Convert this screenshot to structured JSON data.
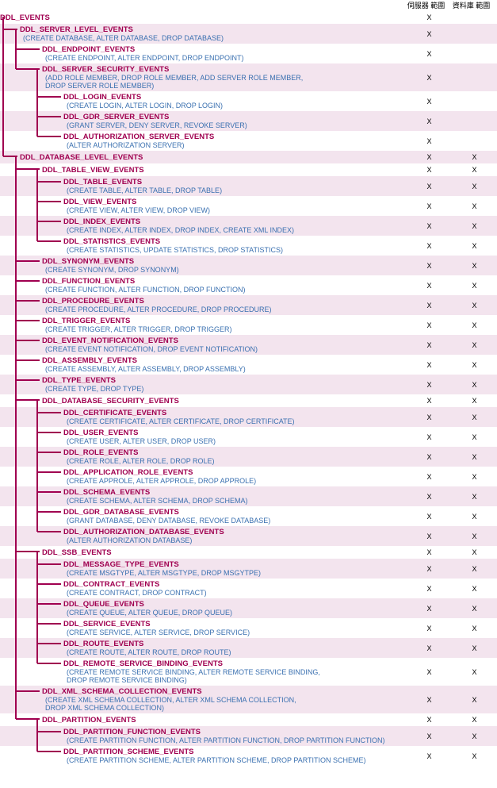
{
  "headers": {
    "server_scope": "伺服器\n範圍",
    "database_scope": "資料庫\n範圍"
  },
  "tree": [
    {
      "id": "ddl_events",
      "level": 0,
      "title": "DDL_EVENTS",
      "desc": "",
      "server": "X",
      "db": "",
      "stripe": false
    },
    {
      "id": "server_level",
      "level": 1,
      "title": "DDL_SERVER_LEVEL_EVENTS",
      "desc": "(CREATE DATABASE, ALTER DATABASE, DROP DATABASE)",
      "server": "X",
      "db": "",
      "stripe": true
    },
    {
      "id": "endpoint",
      "level": 2,
      "title": "DDL_ENDPOINT_EVENTS",
      "desc": "(CREATE ENDPOINT, ALTER ENDPOINT, DROP ENDPOINT)",
      "server": "X",
      "db": "",
      "stripe": false
    },
    {
      "id": "server_security",
      "level": 2,
      "title": "DDL_SERVER_SECURITY_EVENTS",
      "desc": "(ADD ROLE MEMBER, DROP ROLE MEMBER, ADD SERVER ROLE MEMBER,\n DROP SERVER ROLE MEMBER)",
      "server": "X",
      "db": "",
      "stripe": true,
      "multi": true
    },
    {
      "id": "login",
      "level": 3,
      "title": "DDL_LOGIN_EVENTS",
      "desc": "(CREATE LOGIN, ALTER LOGIN, DROP LOGIN)",
      "server": "X",
      "db": "",
      "stripe": false
    },
    {
      "id": "gdr_server",
      "level": 3,
      "title": "DDL_GDR_SERVER_EVENTS",
      "desc": "(GRANT SERVER, DENY SERVER, REVOKE SERVER)",
      "server": "X",
      "db": "",
      "stripe": true
    },
    {
      "id": "auth_server",
      "level": 3,
      "title": "DDL_AUTHORIZATION_SERVER_EVENTS",
      "desc": "(ALTER AUTHORIZATION SERVER)",
      "server": "X",
      "db": "",
      "stripe": false
    },
    {
      "id": "database_level",
      "level": 1,
      "title": "DDL_DATABASE_LEVEL_EVENTS",
      "desc": "",
      "server": "X",
      "db": "X",
      "stripe": true
    },
    {
      "id": "table_view",
      "level": 2,
      "title": "DDL_TABLE_VIEW_EVENTS",
      "desc": "",
      "server": "X",
      "db": "X",
      "stripe": false
    },
    {
      "id": "table",
      "level": 3,
      "title": "DDL_TABLE_EVENTS",
      "desc": "(CREATE TABLE, ALTER TABLE, DROP TABLE)",
      "server": "X",
      "db": "X",
      "stripe": true
    },
    {
      "id": "view",
      "level": 3,
      "title": "DDL_VIEW_EVENTS",
      "desc": "(CREATE VIEW, ALTER VIEW, DROP VIEW)",
      "server": "X",
      "db": "X",
      "stripe": false
    },
    {
      "id": "index",
      "level": 3,
      "title": "DDL_INDEX_EVENTS",
      "desc": "(CREATE INDEX, ALTER INDEX, DROP INDEX, CREATE XML INDEX)",
      "server": "X",
      "db": "X",
      "stripe": true
    },
    {
      "id": "statistics",
      "level": 3,
      "title": "DDL_STATISTICS_EVENTS",
      "desc": "(CREATE STATISTICS, UPDATE STATISTICS, DROP STATISTICS)",
      "server": "X",
      "db": "X",
      "stripe": false
    },
    {
      "id": "synonym",
      "level": 2,
      "title": "DDL_SYNONYM_EVENTS",
      "desc": "(CREATE SYNONYM, DROP SYNONYM)",
      "server": "X",
      "db": "X",
      "stripe": true
    },
    {
      "id": "function",
      "level": 2,
      "title": "DDL_FUNCTION_EVENTS",
      "desc": "(CREATE FUNCTION, ALTER FUNCTION, DROP FUNCTION)",
      "server": "X",
      "db": "X",
      "stripe": false
    },
    {
      "id": "procedure",
      "level": 2,
      "title": "DDL_PROCEDURE_EVENTS",
      "desc": "(CREATE PROCEDURE, ALTER PROCEDURE, DROP PROCEDURE)",
      "server": "X",
      "db": "X",
      "stripe": true
    },
    {
      "id": "trigger",
      "level": 2,
      "title": "DDL_TRIGGER_EVENTS",
      "desc": "(CREATE TRIGGER, ALTER TRIGGER, DROP TRIGGER)",
      "server": "X",
      "db": "X",
      "stripe": false
    },
    {
      "id": "event_notif",
      "level": 2,
      "title": "DDL_EVENT_NOTIFICATION_EVENTS",
      "desc": "(CREATE EVENT NOTIFICATION, DROP EVENT NOTIFICATION)",
      "server": "X",
      "db": "X",
      "stripe": true
    },
    {
      "id": "assembly",
      "level": 2,
      "title": "DDL_ASSEMBLY_EVENTS",
      "desc": "(CREATE ASSEMBLY, ALTER ASSEMBLY, DROP ASSEMBLY)",
      "server": "X",
      "db": "X",
      "stripe": false
    },
    {
      "id": "type",
      "level": 2,
      "title": "DDL_TYPE_EVENTS",
      "desc": "(CREATE TYPE, DROP TYPE)",
      "server": "X",
      "db": "X",
      "stripe": true
    },
    {
      "id": "db_security",
      "level": 2,
      "title": "DDL_DATABASE_SECURITY_EVENTS",
      "desc": "",
      "server": "X",
      "db": "X",
      "stripe": false
    },
    {
      "id": "certificate",
      "level": 3,
      "title": "DDL_CERTIFICATE_EVENTS",
      "desc": "(CREATE CERTIFICATE, ALTER CERTIFICATE, DROP CERTIFICATE)",
      "server": "X",
      "db": "X",
      "stripe": true
    },
    {
      "id": "user",
      "level": 3,
      "title": "DDL_USER_EVENTS",
      "desc": "(CREATE USER, ALTER USER, DROP USER)",
      "server": "X",
      "db": "X",
      "stripe": false
    },
    {
      "id": "role",
      "level": 3,
      "title": "DDL_ROLE_EVENTS",
      "desc": "(CREATE ROLE, ALTER ROLE, DROP ROLE)",
      "server": "X",
      "db": "X",
      "stripe": true
    },
    {
      "id": "app_role",
      "level": 3,
      "title": "DDL_APPLICATION_ROLE_EVENTS",
      "desc": "(CREATE APPROLE, ALTER APPROLE, DROP APPROLE)",
      "server": "X",
      "db": "X",
      "stripe": false
    },
    {
      "id": "schema",
      "level": 3,
      "title": "DDL_SCHEMA_EVENTS",
      "desc": "(CREATE SCHEMA, ALTER SCHEMA, DROP SCHEMA)",
      "server": "X",
      "db": "X",
      "stripe": true
    },
    {
      "id": "gdr_db",
      "level": 3,
      "title": "DDL_GDR_DATABASE_EVENTS",
      "desc": "(GRANT DATABASE, DENY DATABASE, REVOKE DATABASE)",
      "server": "X",
      "db": "X",
      "stripe": false
    },
    {
      "id": "auth_db",
      "level": 3,
      "title": "DDL_AUTHORIZATION_DATABASE_EVENTS",
      "desc": "(ALTER AUTHORIZATION DATABASE)",
      "server": "X",
      "db": "X",
      "stripe": true
    },
    {
      "id": "ssb",
      "level": 2,
      "title": "DDL_SSB_EVENTS",
      "desc": "",
      "server": "X",
      "db": "X",
      "stripe": false
    },
    {
      "id": "msg_type",
      "level": 3,
      "title": "DDL_MESSAGE_TYPE_EVENTS",
      "desc": "(CREATE MSGTYPE, ALTER MSGTYPE, DROP MSGYTPE)",
      "server": "X",
      "db": "X",
      "stripe": true
    },
    {
      "id": "contract",
      "level": 3,
      "title": "DDL_CONTRACT_EVENTS",
      "desc": "(CREATE CONTRACT, DROP CONTRACT)",
      "server": "X",
      "db": "X",
      "stripe": false
    },
    {
      "id": "queue",
      "level": 3,
      "title": "DDL_QUEUE_EVENTS",
      "desc": "(CREATE QUEUE, ALTER QUEUE, DROP QUEUE)",
      "server": "X",
      "db": "X",
      "stripe": true
    },
    {
      "id": "service",
      "level": 3,
      "title": "DDL_SERVICE_EVENTS",
      "desc": "(CREATE SERVICE, ALTER SERVICE, DROP SERVICE)",
      "server": "X",
      "db": "X",
      "stripe": false
    },
    {
      "id": "route",
      "level": 3,
      "title": "DDL_ROUTE_EVENTS",
      "desc": "(CREATE ROUTE, ALTER ROUTE, DROP ROUTE)",
      "server": "X",
      "db": "X",
      "stripe": true
    },
    {
      "id": "remote_svc",
      "level": 3,
      "title": "DDL_REMOTE_SERVICE_BINDING_EVENTS",
      "desc": "(CREATE REMOTE SERVICE BINDING, ALTER REMOTE SERVICE BINDING,\n DROP REMOTE SERVICE BINDING)",
      "server": "X",
      "db": "X",
      "stripe": false,
      "multi": true
    },
    {
      "id": "xml_schema",
      "level": 2,
      "title": "DDL_XML_SCHEMA_COLLECTION_EVENTS",
      "desc": "(CREATE XML SCHEMA COLLECTION, ALTER XML SCHEMA COLLECTION,\n DROP XML SCHEMA COLLECTION)",
      "server": "X",
      "db": "X",
      "stripe": true,
      "multi": true
    },
    {
      "id": "partition",
      "level": 2,
      "title": "DDL_PARTITION_EVENTS",
      "desc": "",
      "server": "X",
      "db": "X",
      "stripe": false
    },
    {
      "id": "part_func",
      "level": 3,
      "title": "DDL_PARTITION_FUNCTION_EVENTS",
      "desc": "(CREATE PARTITION FUNCTION, ALTER PARTITION FUNCTION, DROP PARTITION FUNCTION)",
      "server": "X",
      "db": "X",
      "stripe": true
    },
    {
      "id": "part_scheme",
      "level": 3,
      "title": "DDL_PARTITION_SCHEME_EVENTS",
      "desc": "(CREATE PARTITION SCHEME, ALTER PARTITION SCHEME, DROP PARTITION SCHEME)",
      "server": "X",
      "db": "X",
      "stripe": false
    }
  ]
}
